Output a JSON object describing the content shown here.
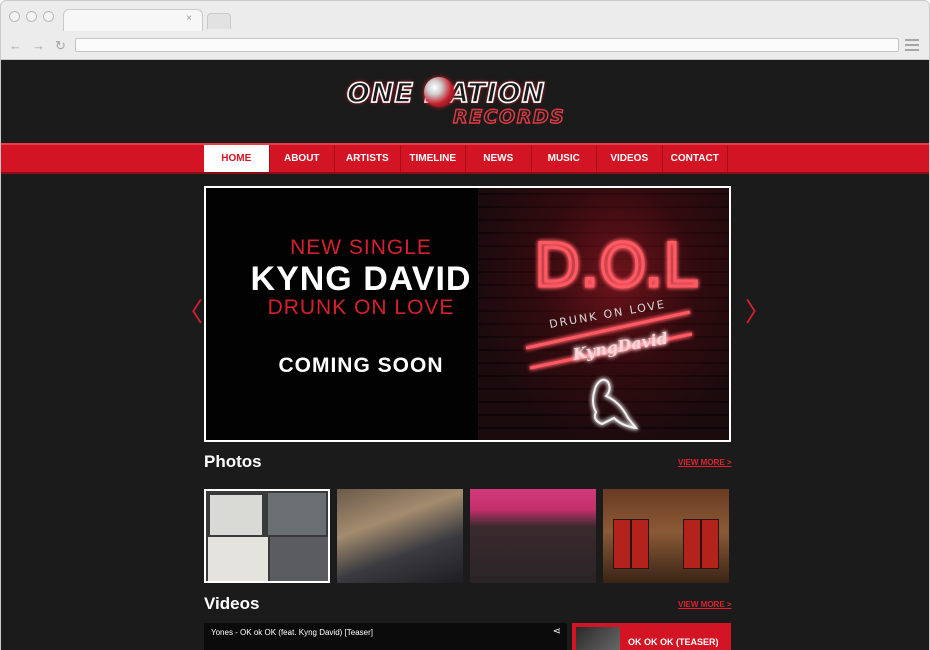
{
  "browser": {
    "tab_close": "×",
    "nav": {
      "back": "←",
      "forward": "→",
      "reload": "↻"
    }
  },
  "logo": {
    "line1": "ONE NATION",
    "line2": "RECORDS"
  },
  "nav": [
    {
      "label": "HOME",
      "active": true
    },
    {
      "label": "ABOUT"
    },
    {
      "label": "ARTISTS"
    },
    {
      "label": "TIMELINE"
    },
    {
      "label": "NEWS"
    },
    {
      "label": "MUSIC"
    },
    {
      "label": "VIDEOS"
    },
    {
      "label": "CONTACT"
    }
  ],
  "hero": {
    "new_single": "NEW SINGLE",
    "artist": "KYNG DAVID",
    "track": "DRUNK ON LOVE",
    "coming_soon": "COMING SOON",
    "art": {
      "big": "D.O.L",
      "sub": "DRUNK ON LOVE",
      "sig": "KyngDavid"
    },
    "prev_arrow": "〈",
    "next_arrow": "〉"
  },
  "photos": {
    "title": "Photos",
    "view_more": "VIEW MORE >"
  },
  "videos": {
    "title": "Videos",
    "view_more": "VIEW MORE >",
    "player_title": "Yones - OK ok OK (feat. Kyng David) [Teaser]",
    "share_icon": "share-icon",
    "card_label": "OK OK OK (TEASER)"
  },
  "colors": {
    "brand_red": "#d21424",
    "accent_red": "#e0222f",
    "background": "#1b1b1b"
  }
}
